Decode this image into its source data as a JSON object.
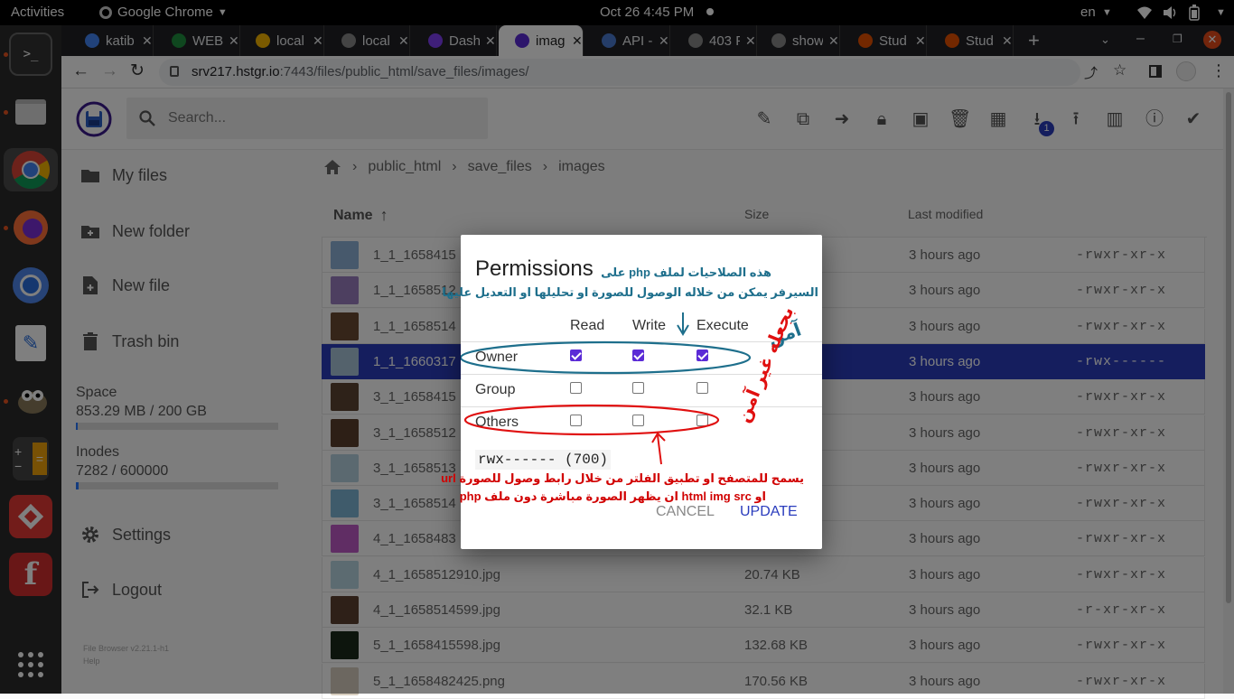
{
  "system_bar": {
    "activities": "Activities",
    "app_menu": "Google Chrome",
    "clock": "Oct 26  4:45 PM",
    "language": "en"
  },
  "browser": {
    "tabs": [
      {
        "label": "katib",
        "color": "#4285f4"
      },
      {
        "label": "WEB",
        "color": "#1e8e3e"
      },
      {
        "label": "local",
        "color": "#f4b400"
      },
      {
        "label": "local",
        "color": "#888888"
      },
      {
        "label": "Dash",
        "color": "#7e3ff2"
      },
      {
        "label": "imag",
        "color": "#5b2bd6"
      },
      {
        "label": "API -",
        "color": "#4a7bd0"
      },
      {
        "label": "403 F",
        "color": "#888888"
      },
      {
        "label": "show",
        "color": "#888888"
      },
      {
        "label": "Stud",
        "color": "#e65100"
      },
      {
        "label": "Stud",
        "color": "#e65100"
      }
    ],
    "url_host": "srv217.hstgr.io",
    "url_path": ":7443/files/public_html/save_files/images/"
  },
  "app": {
    "search_placeholder": "Search...",
    "download_badge": "1",
    "sidebar": {
      "my_files": "My files",
      "new_folder": "New folder",
      "new_file": "New file",
      "trash": "Trash bin",
      "space_label": "Space",
      "space_value": "853.29 MB / 200 GB",
      "space_fraction": 0.004,
      "inodes_label": "Inodes",
      "inodes_value": "7282 / 600000",
      "inodes_fraction": 0.012,
      "settings": "Settings",
      "logout": "Logout",
      "version": "File Browser v2.21.1-h1",
      "help": "Help"
    },
    "breadcrumb": [
      "public_html",
      "save_files",
      "images"
    ],
    "columns": {
      "name": "Name",
      "size": "Size",
      "modified": "Last modified"
    },
    "files": [
      {
        "name": "1_1_1658415",
        "size": "",
        "modified": "3 hours ago",
        "perm": "-rwxr-xr-x",
        "thumb": "#8fb3d9"
      },
      {
        "name": "1_1_1658512",
        "size": "",
        "modified": "3 hours ago",
        "perm": "-rwxr-xr-x",
        "thumb": "#9a7fc0"
      },
      {
        "name": "1_1_1658514",
        "size": "",
        "modified": "3 hours ago",
        "perm": "-rwxr-xr-x",
        "thumb": "#6b4a32"
      },
      {
        "name": "1_1_1660317",
        "size": "",
        "modified": "3 hours ago",
        "perm": "-rwx------",
        "thumb": "#a9c4d8",
        "selected": true
      },
      {
        "name": "3_1_1658415",
        "size": "",
        "modified": "3 hours ago",
        "perm": "-rwxr-xr-x",
        "thumb": "#5d4533"
      },
      {
        "name": "3_1_1658512",
        "size": "",
        "modified": "3 hours ago",
        "perm": "-rwxr-xr-x",
        "thumb": "#5a3f2c"
      },
      {
        "name": "3_1_1658513",
        "size": "",
        "modified": "3 hours ago",
        "perm": "-rwxr-xr-x",
        "thumb": "#b7d3e0"
      },
      {
        "name": "3_1_1658514",
        "size": "",
        "modified": "3 hours ago",
        "perm": "-rwxr-xr-x",
        "thumb": "#7fb6d6"
      },
      {
        "name": "4_1_1658483",
        "size": "",
        "modified": "3 hours ago",
        "perm": "-rwxr-xr-x",
        "thumb": "#c05bc8"
      },
      {
        "name": "4_1_1658512910.jpg",
        "size": "20.74 KB",
        "modified": "3 hours ago",
        "perm": "-rwxr-xr-x",
        "thumb": "#b9d6e3"
      },
      {
        "name": "4_1_1658514599.jpg",
        "size": "32.1 KB",
        "modified": "3 hours ago",
        "perm": "-r-xr-xr-x",
        "thumb": "#5c4130"
      },
      {
        "name": "5_1_1658415598.jpg",
        "size": "132.68 KB",
        "modified": "3 hours ago",
        "perm": "-rwxr-xr-x",
        "thumb": "#1a2a1a"
      },
      {
        "name": "5_1_1658482425.png",
        "size": "170.56 KB",
        "modified": "3 hours ago",
        "perm": "-rwxr-xr-x",
        "thumb": "#d8cfc0"
      }
    ]
  },
  "dialog": {
    "title": "Permissions",
    "col_read": "Read",
    "col_write": "Write",
    "col_execute": "Execute",
    "rows": [
      {
        "label": "Owner",
        "read": true,
        "write": true,
        "execute": true
      },
      {
        "label": "Group",
        "read": false,
        "write": false,
        "execute": false
      },
      {
        "label": "Others",
        "read": false,
        "write": false,
        "execute": false
      }
    ],
    "octal": "rwx------ (700)",
    "cancel": "CANCEL",
    "update": "UPDATE"
  },
  "annotations": {
    "top_line1": "هذه الصلاحيات لملف php على",
    "top_line2": "السيرفر يمكن من خلاله الوصول للصورة او تحليلها او التعديل عليها",
    "safe": "آمن",
    "unsafe": "بجعله غير آمن",
    "bottom_line1": "يسمح للمتصفح او تطبيق الفلتر من خلال رابط وصول للصورة url",
    "bottom_line2": "او html img src ان يظهر الصورة مباشرة دون ملف php"
  }
}
